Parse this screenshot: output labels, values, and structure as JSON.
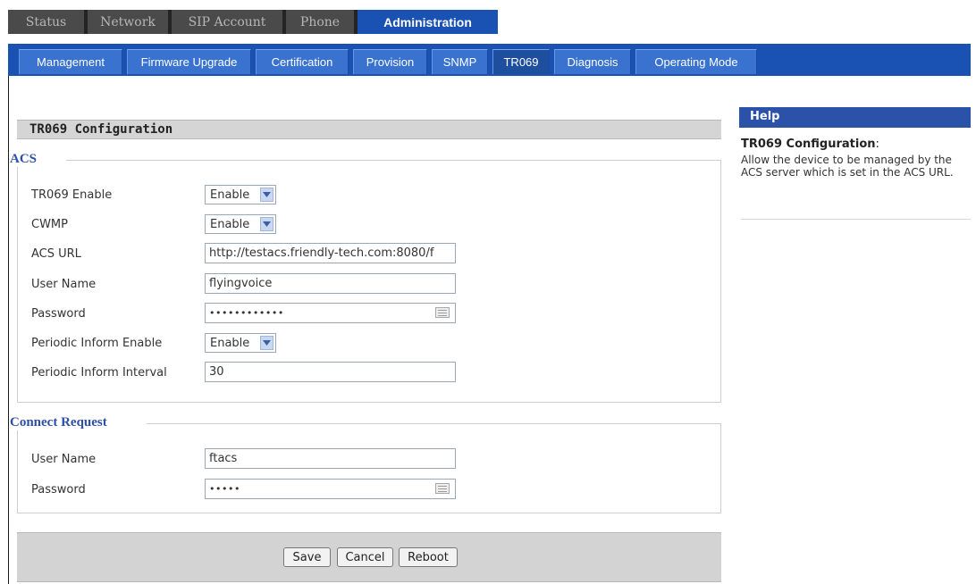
{
  "nav": {
    "top_tabs": [
      "Status",
      "Network",
      "SIP Account",
      "Phone",
      "Administration"
    ],
    "sub_tabs": [
      "Management",
      "Firmware Upgrade",
      "Certification",
      "Provision",
      "SNMP",
      "TR069",
      "Diagnosis",
      "Operating Mode"
    ],
    "active_top": "Administration",
    "active_sub": "TR069"
  },
  "page": {
    "title": "TR069 Configuration"
  },
  "acs": {
    "legend": "ACS",
    "tr069_enable": {
      "label": "TR069 Enable",
      "value": "Enable"
    },
    "cwmp": {
      "label": "CWMP",
      "value": "Enable"
    },
    "acs_url": {
      "label": "ACS URL",
      "value": "http://testacs.friendly-tech.com:8080/f"
    },
    "user_name": {
      "label": "User Name",
      "value": "flyingvoice"
    },
    "password": {
      "label": "Password",
      "value": "••••••••••••"
    },
    "periodic_enable": {
      "label": "Periodic Inform Enable",
      "value": "Enable"
    },
    "periodic_interval": {
      "label": "Periodic Inform Interval",
      "value": "30"
    }
  },
  "connect": {
    "legend": "Connect Request",
    "user_name": {
      "label": "User Name",
      "value": "ftacs"
    },
    "password": {
      "label": "Password",
      "value": "•••••"
    }
  },
  "buttons": {
    "save": "Save",
    "cancel": "Cancel",
    "reboot": "Reboot"
  },
  "help": {
    "header": "Help",
    "title": "TR069 Configuration",
    "title_suffix": ":",
    "body": "Allow the device to be managed by the ACS server which is set in the ACS URL."
  },
  "colors": {
    "accent": "#1a52b3",
    "legend": "#2c50a8",
    "tab_dark": "#242424"
  }
}
